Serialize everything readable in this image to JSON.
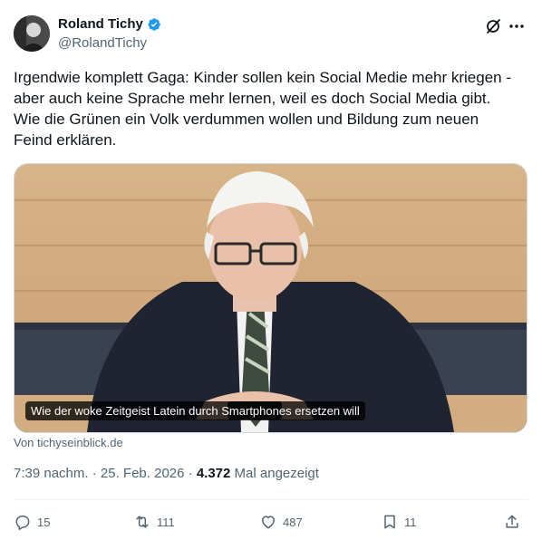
{
  "author": {
    "name": "Roland Tichy",
    "handle": "@RolandTichy"
  },
  "tweet": {
    "lines": [
      "Irgendwie komplett Gaga: Kinder sollen kein Social Medie mehr kriegen -",
      "aber auch keine Sprache mehr lernen, weil es doch Social Media gibt.",
      "Wie die Grünen ein Volk verdummen wollen und Bildung zum neuen",
      "Feind erklären."
    ]
  },
  "card": {
    "caption": "Wie der woke Zeitgeist Latein durch Smartphones ersetzen will",
    "source": "Von tichyseinblick.de"
  },
  "meta": {
    "time": "7:39 nachm.",
    "sep1": " · ",
    "date": "25. Feb. 2026",
    "sep2": " · ",
    "views": "4.372",
    "views_label": " Mal angezeigt"
  },
  "actions": {
    "replies": "15",
    "reposts": "111",
    "likes": "487",
    "bookmarks": "11"
  },
  "icons": {
    "verified": "verified-badge-icon",
    "grok": "grok-icon",
    "more": "more-icon",
    "reply": "reply-icon",
    "repost": "repost-icon",
    "like": "like-icon",
    "bookmark": "bookmark-icon",
    "share": "share-icon"
  },
  "colors": {
    "verified": "#1d9bf0",
    "muted": "#536471",
    "text": "#0f1419"
  }
}
